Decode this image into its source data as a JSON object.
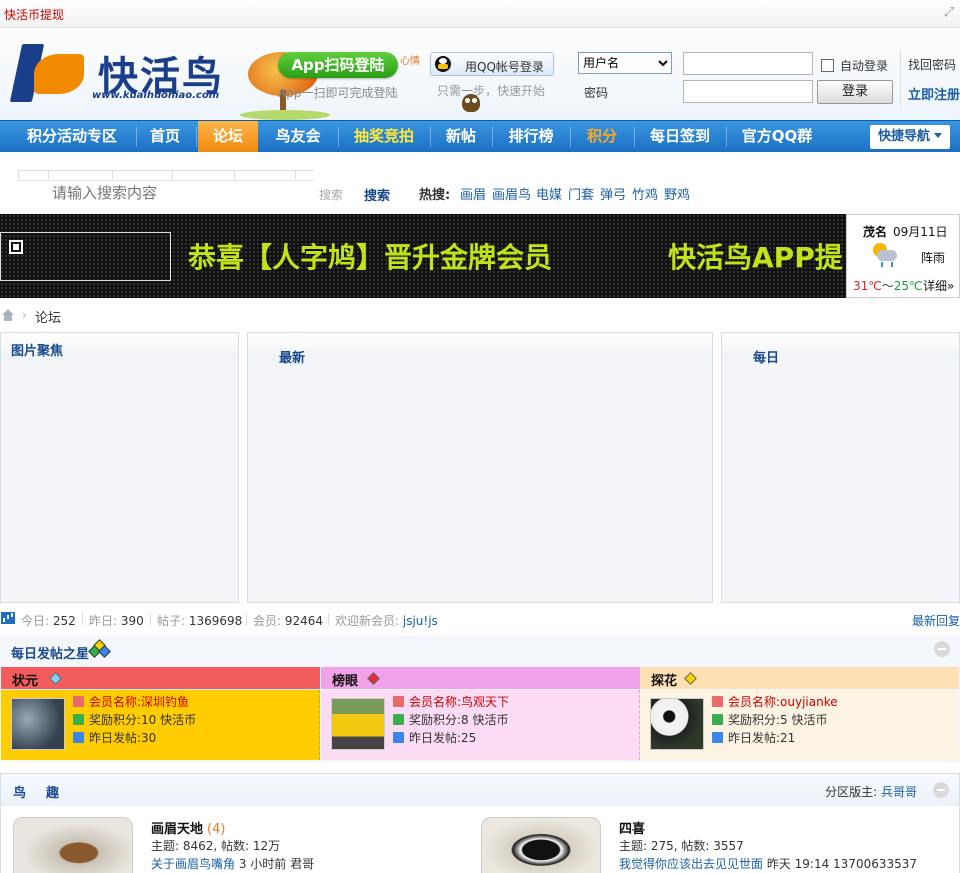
{
  "topbar": {
    "link": "快活币提现"
  },
  "logo": {
    "name": "快活鸟",
    "url": "www.kuaihuoniao.com"
  },
  "app_promo": {
    "button": "App扫码登陆",
    "tag": "心情",
    "sub": "App一扫即可完成登陆"
  },
  "qq": {
    "button": "用QQ帐号登录",
    "sub": "只需一步，快速开始"
  },
  "login": {
    "type_options": [
      "用户名"
    ],
    "password_label": "密码",
    "auto_login": "自动登录",
    "login_button": "登录",
    "find_password": "找回密码",
    "register": "立即注册"
  },
  "nav": {
    "items": [
      {
        "label": "积分活动专区"
      },
      {
        "label": "首页"
      },
      {
        "label": "论坛"
      },
      {
        "label": "鸟友会"
      },
      {
        "label": "抽奖竞拍"
      },
      {
        "label": "新帖"
      },
      {
        "label": "排行榜"
      },
      {
        "label": "积分"
      },
      {
        "label": "每日签到"
      },
      {
        "label": "官方QQ群"
      }
    ],
    "quick_nav": "快捷导航",
    "colors": {
      "bar": "#1c6fc4",
      "active": "#f08a0e",
      "highlight_yellow": "#ffea3b",
      "highlight_orange": "#ffa91f"
    }
  },
  "search": {
    "placeholder": "请输入搜索内容",
    "type": "搜索",
    "button": "搜索",
    "hot_label": "热搜:",
    "hot_items": [
      "画眉",
      "画眉鸟",
      "电媒",
      "门套",
      "弹弓",
      "竹鸡",
      "野鸡"
    ]
  },
  "banner": {
    "messages": [
      "恭喜【人字鸠】晋升金牌会员",
      "快活鸟APP提"
    ],
    "text_color": "#c3e21a"
  },
  "weather": {
    "city": "茂名",
    "date": "09月11日",
    "icon": "sun-cloud-rain-icon",
    "condition": "阵雨",
    "high": "31℃",
    "range_sep": "～",
    "low": "25℃",
    "detail": "详细»"
  },
  "breadcrumb": {
    "current": "论坛"
  },
  "portal": {
    "pictures_title": "图片聚焦",
    "latest_title": "最新",
    "daily_title": "每日"
  },
  "stats": {
    "today_label": "今日: ",
    "today": "252",
    "yesterday_label": "昨日: ",
    "yesterday": "390",
    "posts_label": "帖子: ",
    "posts": "1369698",
    "members_label": "会员: ",
    "members": "92464",
    "newest_label": "欢迎新会员: ",
    "newest": "jsju!js",
    "latest_replies": "最新回复"
  },
  "daily_star": {
    "title": "每日发帖之星",
    "columns": [
      {
        "rank": "状元",
        "name": "会员名称:深圳钓鱼",
        "reward": "奖励积分:10 快活币",
        "yesterday": "昨日发帖:30",
        "photo": "fish-photo"
      },
      {
        "rank": "榜眼",
        "name": "会员名称:鸟观天下",
        "reward": "奖励积分:8 快活币",
        "yesterday": "昨日发帖:25",
        "photo": "yellow-truck-photo"
      },
      {
        "rank": "探花",
        "name": "会员名称:ouyjianke",
        "reward": "奖励积分:5 快活币",
        "yesterday": "昨日发帖:21",
        "photo": "panda-photo"
      }
    ]
  },
  "forum": {
    "title": "鸟趣",
    "moderator_label": "分区版主: ",
    "moderator": "兵哥哥",
    "boards": [
      {
        "name": "画眉天地",
        "new": "(4)",
        "stats": "主题: 8462, 帖数: 12万",
        "last_title": "关于画眉鸟嘴角",
        "last_meta": " 3 小时前 君哥"
      },
      {
        "name": "四喜",
        "new": "",
        "stats": "主题: 275, 帖数: 3557",
        "last_title": "我觉得你应该出去见见世面",
        "last_meta": " 昨天 19:14 13700633537"
      }
    ]
  }
}
